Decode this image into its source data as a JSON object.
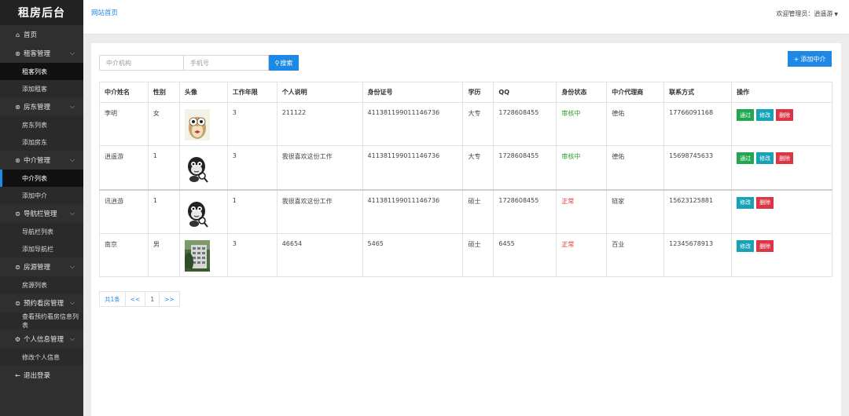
{
  "sidebar": {
    "brand": "租房后台",
    "items": [
      {
        "type": "item",
        "icon": "⌂",
        "label": "首页"
      },
      {
        "type": "group",
        "icon": "⊛",
        "label": "租客管理"
      },
      {
        "type": "sub",
        "label": "租客列表",
        "state": "active"
      },
      {
        "type": "sub",
        "label": "添加租客"
      },
      {
        "type": "group",
        "icon": "⊛",
        "label": "房东管理"
      },
      {
        "type": "sub",
        "label": "房东列表"
      },
      {
        "type": "sub",
        "label": "添加房东"
      },
      {
        "type": "group",
        "icon": "⊛",
        "label": "中介管理"
      },
      {
        "type": "sub",
        "label": "中介列表",
        "state": "current"
      },
      {
        "type": "sub",
        "label": "添加中介"
      },
      {
        "type": "group",
        "icon": "⊜",
        "label": "导航栏管理"
      },
      {
        "type": "sub",
        "label": "导航栏列表"
      },
      {
        "type": "sub",
        "label": "添加导航栏"
      },
      {
        "type": "group",
        "icon": "⊜",
        "label": "房源管理"
      },
      {
        "type": "sub",
        "label": "房源列表"
      },
      {
        "type": "group",
        "icon": "⊜",
        "label": "预约看房管理"
      },
      {
        "type": "sub",
        "label": "查看预约看房信息列表"
      },
      {
        "type": "group",
        "icon": "⚙",
        "label": "个人信息管理"
      },
      {
        "type": "sub",
        "label": "修改个人信息"
      },
      {
        "type": "item",
        "icon": "←",
        "label": "退出登录"
      }
    ]
  },
  "header": {
    "home_link": "网站首页",
    "welcome": "欢迎管理员：逍遥游"
  },
  "search": {
    "agency_placeholder": "中介机构",
    "phone_placeholder": "手机号",
    "search_label": "搜索",
    "add_label": "添加中介"
  },
  "table": {
    "columns": [
      "中介姓名",
      "性别",
      "头像",
      "工作年限",
      "个人说明",
      "身份证号",
      "学历",
      "QQ",
      "身份状态",
      "中介代理商",
      "联系方式",
      "操作"
    ],
    "rows": [
      {
        "name": "李明",
        "gender": "女",
        "avatar": "owl",
        "years": "3",
        "bio": "211122",
        "id_no": "411381199011146736",
        "edu": "大专",
        "qq": "1728608455",
        "status": "审核中",
        "status_color": "#2e9d2e",
        "agent": "德佑",
        "phone": "17766091168",
        "ops": [
          "通过",
          "修改",
          "删除"
        ]
      },
      {
        "name": "逍遥游",
        "gender": "1",
        "avatar": "gorilla",
        "years": "3",
        "bio": "我很喜欢这份工作",
        "id_no": "411381199011146736",
        "edu": "大专",
        "qq": "1728608455",
        "status": "审核中",
        "status_color": "#2e9d2e",
        "agent": "德佑",
        "phone": "15698745633",
        "ops": [
          "通过",
          "修改",
          "删除"
        ]
      },
      {
        "name": "讯逍游",
        "gender": "1",
        "avatar": "gorilla",
        "years": "1",
        "bio": "我很喜欢这份工作",
        "id_no": "411381199011146736",
        "edu": "硕士",
        "qq": "1728608455",
        "status": "正常",
        "status_color": "#e53935",
        "agent": "链家",
        "phone": "15623125881",
        "ops": [
          "修改",
          "删除"
        ]
      },
      {
        "name": "南京",
        "gender": "男",
        "avatar": "building",
        "years": "3",
        "bio": "46654",
        "id_no": "5465",
        "edu": "硕士",
        "qq": "6455",
        "status": "正常",
        "status_color": "#e53935",
        "agent": "百业",
        "phone": "12345678913",
        "ops": [
          "修改",
          "删除"
        ]
      }
    ]
  },
  "pager": {
    "total": "共1条",
    "prev": "<<",
    "page": "1",
    "next": ">>"
  },
  "colors": {
    "accent": "#1e88e5",
    "sidebar_bg": "#2f2f2f",
    "pass": "#22a64f",
    "edit": "#17a2b8",
    "delete": "#dc3545"
  }
}
